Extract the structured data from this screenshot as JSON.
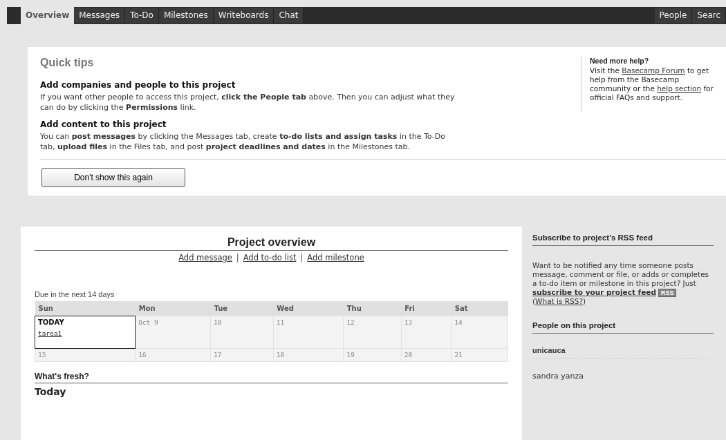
{
  "tabs": [
    {
      "label": "Overview",
      "selected": true
    },
    {
      "label": "Messages",
      "selected": false
    },
    {
      "label": "To-Do",
      "selected": false
    },
    {
      "label": "Milestones",
      "selected": false
    },
    {
      "label": "Writeboards",
      "selected": false
    },
    {
      "label": "Chat",
      "selected": false
    }
  ],
  "right_tabs": [
    {
      "label": "People",
      "selected": false
    },
    {
      "label": "Searc",
      "selected": false
    }
  ],
  "quick_tips": {
    "title": "Quick tips",
    "sections": [
      {
        "heading": "Add companies and people to this project",
        "text": "If you want other people to access this project, **click the People tab** above. Then you can adjust what they can do by clicking the **Permissions** link."
      },
      {
        "heading": "Add content to this project",
        "text": "You can **post messages** by clicking the Messages tab, create **to-do lists and assign tasks** in the To-Do tab, **upload files** in the Files tab, and post **project deadlines and dates** in the Milestones tab."
      }
    ],
    "button": "Don't show this again",
    "help": {
      "heading": "Need more help?",
      "parts": [
        {
          "kind": "text",
          "text": "Visit the "
        },
        {
          "kind": "link",
          "text": "Basecamp Forum"
        },
        {
          "kind": "text",
          "text": " to get help from the Basecamp community or the "
        },
        {
          "kind": "link",
          "text": "help section"
        },
        {
          "kind": "text",
          "text": " for official FAQs and support."
        }
      ]
    }
  },
  "overview": {
    "title": "Project overview",
    "actions": [
      "Add message",
      "Add to-do list",
      "Add milestone"
    ],
    "separator": "|",
    "calendar_caption": "Due in the next 14 days",
    "days": [
      "Sun",
      "Mon",
      "Tue",
      "Wed",
      "Thu",
      "Fri",
      "Sat"
    ],
    "weeks": [
      [
        {
          "label": "TODAY",
          "today": true,
          "event": "tarea1"
        },
        {
          "label": "Oct 9",
          "today": false
        },
        {
          "label": "10",
          "today": false
        },
        {
          "label": "11",
          "today": false
        },
        {
          "label": "12",
          "today": false
        },
        {
          "label": "13",
          "today": false
        },
        {
          "label": "14",
          "today": false
        }
      ],
      [
        {
          "label": "15",
          "today": false
        },
        {
          "label": "16",
          "today": false
        },
        {
          "label": "17",
          "today": false
        },
        {
          "label": "18",
          "today": false
        },
        {
          "label": "19",
          "today": false
        },
        {
          "label": "20",
          "today": false
        },
        {
          "label": "21",
          "today": false
        }
      ]
    ],
    "fresh_title": "What's fresh?",
    "fresh_day": "Today"
  },
  "sidebar": {
    "rss_title": "Subscribe to project's RSS feed",
    "rss_text": "Want to be notified any time someone posts message, comment or file, or adds or completes a to-do item or milestone in this project? Just ",
    "rss_link": "subscribe to your project feed",
    "rss_badge": "RSS",
    "help_open": "(",
    "help_link": "What is RSS?",
    "help_close": ")",
    "people_title": "People on this project",
    "people": [
      {
        "name": "unicauca",
        "kind": "company"
      },
      {
        "name": "sandra yanza",
        "kind": "person"
      }
    ]
  }
}
